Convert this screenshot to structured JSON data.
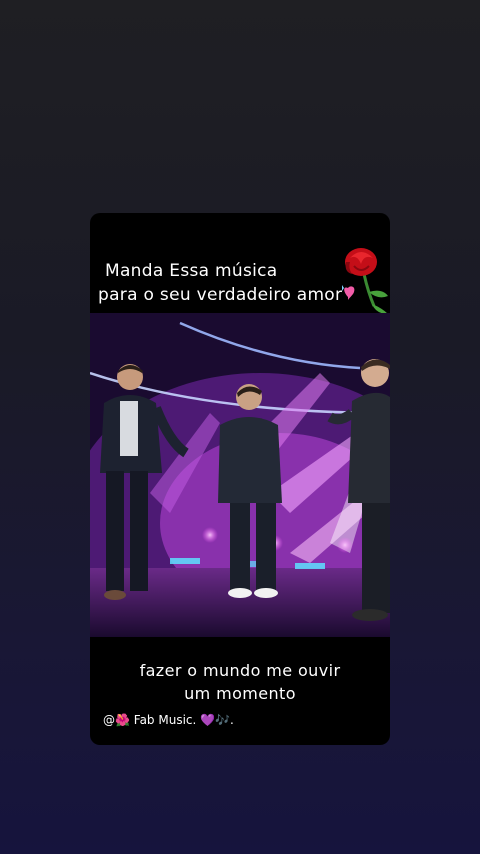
{
  "story": {
    "caption_top_line1": "Manda Essa música",
    "caption_top_line2": "para o seu verdadeiro amor",
    "caption_bottom_line1": "fazer o mundo me ouvir",
    "caption_bottom_line2": "um momento",
    "credit_at": "@",
    "credit_flower": "🌺",
    "credit_name": " Fab Music. ",
    "credit_heart": "💜",
    "credit_notes": "🎶."
  },
  "icons": {
    "rose": "rose-sticker",
    "heart": "sparkling-heart-sticker"
  },
  "colors": {
    "background_top": "#1f1f23",
    "background_bottom": "#16143d",
    "card": "#000000",
    "stage_purple": "#7a2a9c",
    "stage_pink": "#c85ad0"
  }
}
